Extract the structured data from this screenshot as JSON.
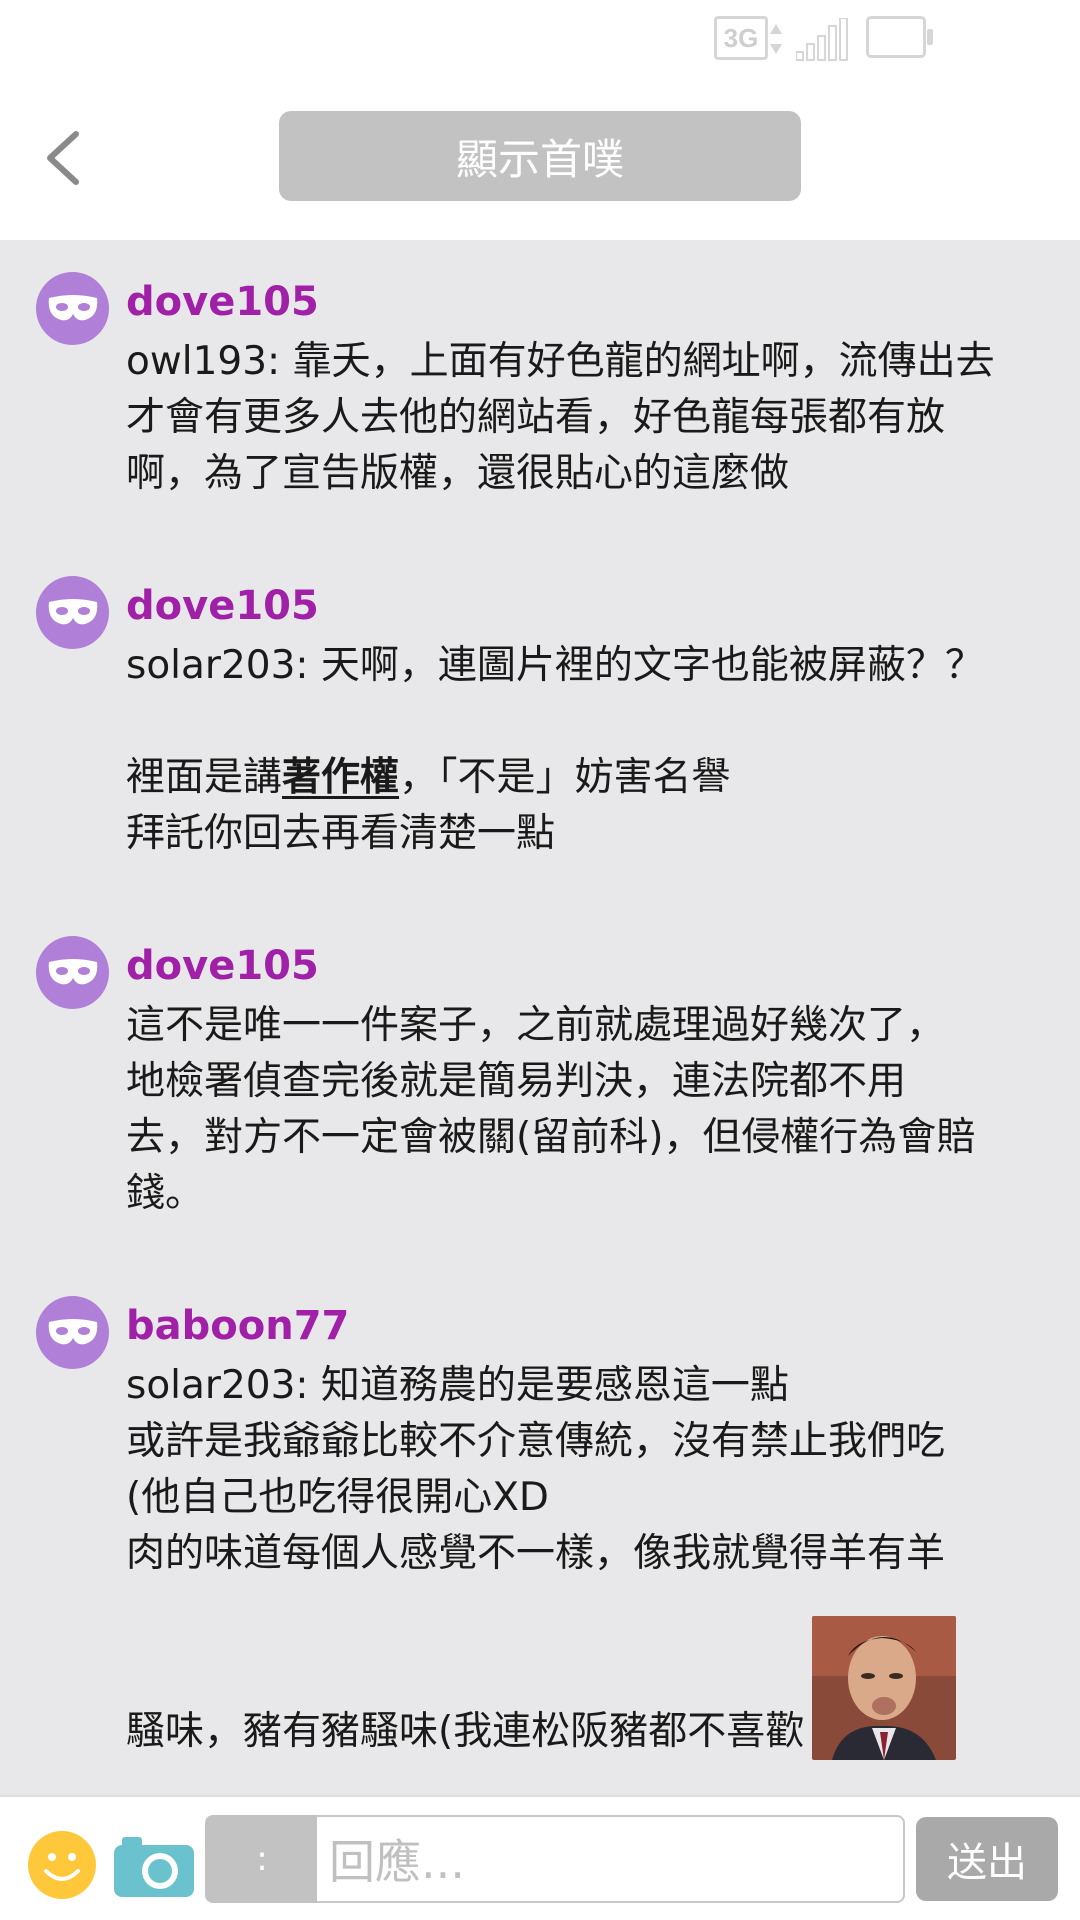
{
  "status_bar": {
    "network": "3G",
    "icons": [
      "network-3g-icon",
      "signal-icon",
      "battery-icon"
    ]
  },
  "header": {
    "back_icon": "chevron-left-icon",
    "show_first_label": "顯示首噗"
  },
  "responses": [
    {
      "author": "dove105",
      "avatar_icon": "mask-icon",
      "lines": [
        "owl193: 靠夭，上面有好色龍的網址啊，流傳出去",
        "才會有更多人去他的網站看，好色龍每張都有放",
        "啊，為了宣告版權，還很貼心的這麼做"
      ]
    },
    {
      "author": "dove105",
      "avatar_icon": "mask-icon",
      "lines": [
        "solar203: 天啊，連圖片裡的文字也能被屏蔽？？",
        "",
        "裡面是講",
        "著作權",
        "，「不是」妨害名譽",
        "拜託你回去再看清楚一點"
      ]
    },
    {
      "author": "dove105",
      "avatar_icon": "mask-icon",
      "lines": [
        "這不是唯一一件案子，之前就處理過好幾次了，",
        "地檢署偵查完後就是簡易判決，連法院都不用",
        "去，對方不一定會被關(留前科)，但侵權行為會賠",
        "錢。"
      ]
    },
    {
      "author": "baboon77",
      "avatar_icon": "mask-icon",
      "lines": [
        "solar203: 知道務農的是要感恩這一點",
        "或許是我爺爺比較不介意傳統，沒有禁止我們吃",
        "(他自己也吃得很開心XD",
        "肉的味道每個人感覺不一樣，像我就覺得羊有羊",
        "騷味，豬有豬騷味(我連松阪豬都不喜歡"
      ]
    }
  ],
  "input_bar": {
    "emoji_icon": "smiley-icon",
    "camera_icon": "camera-icon",
    "qualifier_label": ":",
    "reply_placeholder": "回應...",
    "send_label": "送出"
  },
  "colors": {
    "author": "#a020a8",
    "avatar": "#b07fd8",
    "feed_bg": "#e8e8ea",
    "button_gray": "#c2c2c2"
  }
}
